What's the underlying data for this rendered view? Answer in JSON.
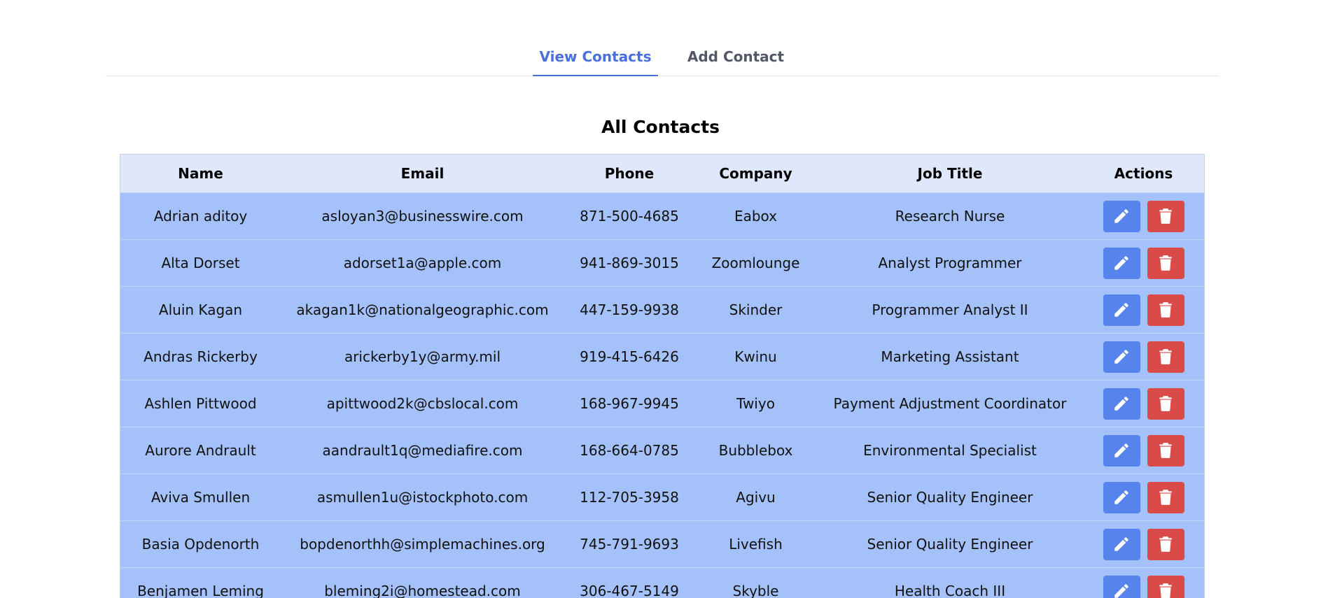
{
  "tabs": [
    {
      "label": "View Contacts",
      "active": true
    },
    {
      "label": "Add Contact",
      "active": false
    }
  ],
  "page_title": "All Contacts",
  "table": {
    "headers": [
      "Name",
      "Email",
      "Phone",
      "Company",
      "Job Title",
      "Actions"
    ],
    "rows": [
      {
        "name": "Adrian aditoy",
        "email": "asloyan3@businesswire.com",
        "phone": "871-500-4685",
        "company": "Eabox",
        "job_title": "Research Nurse"
      },
      {
        "name": "Alta Dorset",
        "email": "adorset1a@apple.com",
        "phone": "941-869-3015",
        "company": "Zoomlounge",
        "job_title": "Analyst Programmer"
      },
      {
        "name": "Aluin Kagan",
        "email": "akagan1k@nationalgeographic.com",
        "phone": "447-159-9938",
        "company": "Skinder",
        "job_title": "Programmer Analyst II"
      },
      {
        "name": "Andras Rickerby",
        "email": "arickerby1y@army.mil",
        "phone": "919-415-6426",
        "company": "Kwinu",
        "job_title": "Marketing Assistant"
      },
      {
        "name": "Ashlen Pittwood",
        "email": "apittwood2k@cbslocal.com",
        "phone": "168-967-9945",
        "company": "Twiyo",
        "job_title": "Payment Adjustment Coordinator"
      },
      {
        "name": "Aurore Andrault",
        "email": "aandrault1q@mediafire.com",
        "phone": "168-664-0785",
        "company": "Bubblebox",
        "job_title": "Environmental Specialist"
      },
      {
        "name": "Aviva Smullen",
        "email": "asmullen1u@istockphoto.com",
        "phone": "112-705-3958",
        "company": "Agivu",
        "job_title": "Senior Quality Engineer"
      },
      {
        "name": "Basia Opdenorth",
        "email": "bopdenorthh@simplemachines.org",
        "phone": "745-791-9693",
        "company": "Livefish",
        "job_title": "Senior Quality Engineer"
      },
      {
        "name": "Benjamen Leming",
        "email": "bleming2i@homestead.com",
        "phone": "306-467-5149",
        "company": "Skyble",
        "job_title": "Health Coach III"
      }
    ]
  },
  "icons": {
    "edit": "pencil-icon",
    "delete": "trash-icon"
  },
  "colors": {
    "accent": "#4a6fde",
    "header_bg": "#dfe8fb",
    "row_bg": "#a4c1f9",
    "edit_button": "#5683ec",
    "delete_button": "#d94a48"
  }
}
